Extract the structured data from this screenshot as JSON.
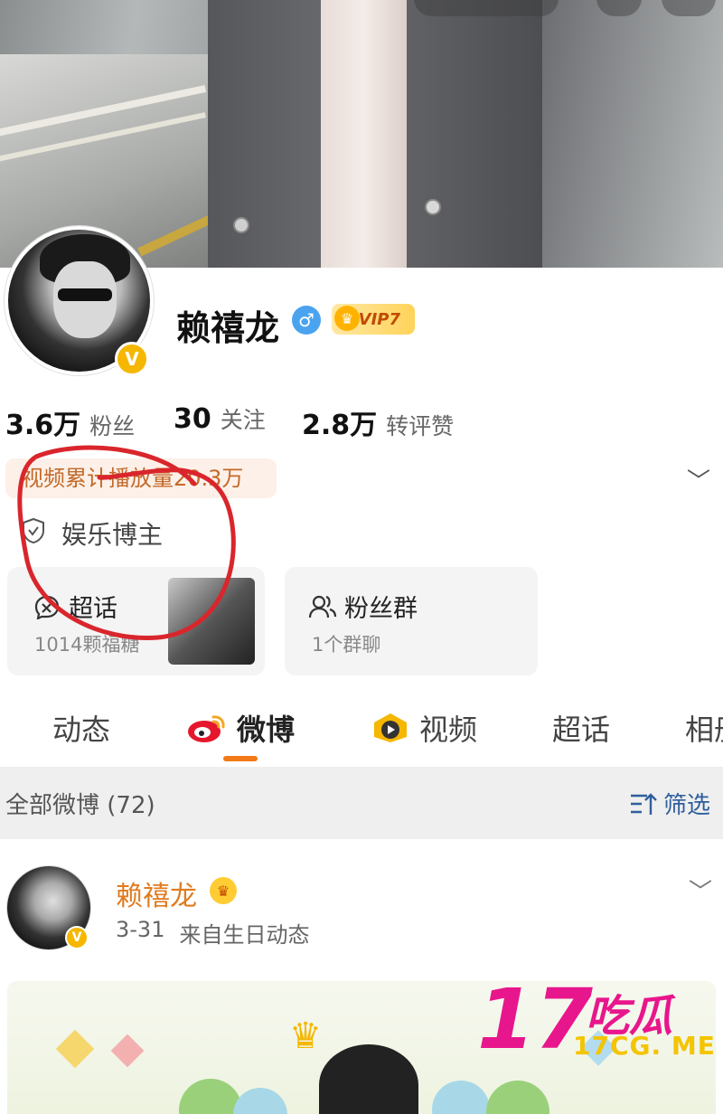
{
  "profile": {
    "name": "赖禧龙",
    "vip_label": "VIP7",
    "stats": [
      {
        "value": "3.6万",
        "label": "粉丝"
      },
      {
        "value": "30",
        "label": "关注"
      },
      {
        "value": "2.8万",
        "label": "转评赞"
      }
    ],
    "play_badge": "视频累计播放量20.3万",
    "category": "娱乐博主"
  },
  "cards": {
    "supertopic": {
      "title": "超话",
      "sub": "1014颗福糖"
    },
    "fans_group": {
      "title": "粉丝群",
      "sub": "1个群聊"
    }
  },
  "tabs": [
    "动态",
    "微博",
    "视频",
    "超话",
    "相册"
  ],
  "active_tab": "微博",
  "filter": {
    "count_label": "全部微博 (72)",
    "button_label": "筛选"
  },
  "post": {
    "author": "赖禧龙",
    "date": "3-31",
    "source": "来自生日动态"
  },
  "watermark": {
    "brand_number": "17",
    "brand_cn": "吃瓜",
    "domain": "17CG. ME"
  },
  "colors": {
    "accent": "#f27a18",
    "watermark": "#e8168c",
    "annotation": "#d9262c",
    "link": "#2f5e9d"
  },
  "icons": [
    "verified-badge-icon",
    "male-icon",
    "vip-crown-icon",
    "shield-icon",
    "chevron-down-icon",
    "supertopic-icon",
    "group-icon",
    "weibo-logo-icon",
    "video-icon",
    "filter-icon"
  ]
}
